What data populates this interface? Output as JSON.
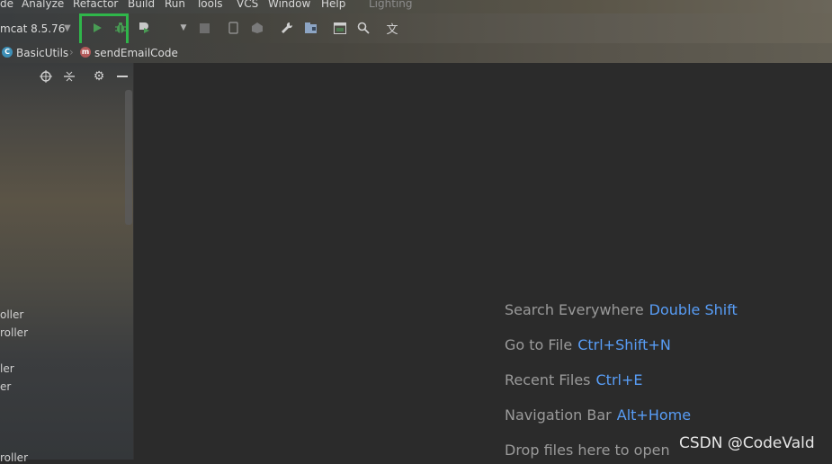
{
  "menu": {
    "items": [
      "de",
      "Analyze",
      "Refactor",
      "Build",
      "Run",
      "Tools",
      "VCS",
      "Window",
      "Help"
    ],
    "extra": "Lighting"
  },
  "toolbar": {
    "run_config": "mcat 8.5.76",
    "icons": [
      "run-icon",
      "debug-icon",
      "coverage-icon",
      "more-dropdown-icon",
      "stop-icon",
      "device-icon",
      "attach-icon",
      "wrench-icon",
      "project-structure-icon",
      "terminal-icon",
      "search-icon",
      "translate-icon"
    ],
    "highlight_color": "#2fb64a"
  },
  "breadcrumb": {
    "class_name": "BasicUtils",
    "method_name": "sendEmailCode"
  },
  "project_panel": {
    "tree_items": [
      "oller",
      "roller",
      "ler",
      "er",
      "roller"
    ]
  },
  "editor_hints": [
    {
      "label": "Search Everywhere",
      "shortcut": "Double Shift"
    },
    {
      "label": "Go to File",
      "shortcut": "Ctrl+Shift+N"
    },
    {
      "label": "Recent Files",
      "shortcut": "Ctrl+E"
    },
    {
      "label": "Navigation Bar",
      "shortcut": "Alt+Home"
    },
    {
      "label": "Drop files here to open",
      "shortcut": ""
    }
  ],
  "watermark": "CSDN @CodeVald",
  "colors": {
    "editor_bg": "#2b2b2b",
    "shortcut_blue": "#589df6",
    "run_green": "#499c54"
  }
}
